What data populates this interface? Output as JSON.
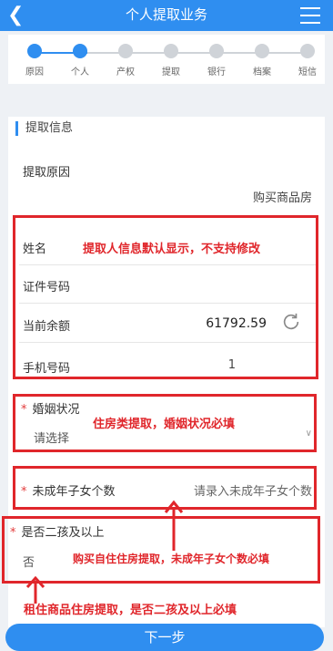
{
  "header": {
    "title": "个人提取业务"
  },
  "steps": [
    {
      "label": "原因",
      "done": true
    },
    {
      "label": "个人",
      "done": true
    },
    {
      "label": "产权",
      "done": false
    },
    {
      "label": "提取",
      "done": false
    },
    {
      "label": "银行",
      "done": false
    },
    {
      "label": "档案",
      "done": false
    },
    {
      "label": "短信",
      "done": false
    }
  ],
  "info": {
    "section_title": "提取信息",
    "reason_label": "提取原因",
    "reason_value": "购买商品房",
    "name_label": "姓名",
    "id_label": "证件号码",
    "balance_label": "当前余额",
    "balance_value": "61792.59",
    "phone_label": "手机号码",
    "phone_value": "1",
    "marriage_label": "婚姻状况",
    "marriage_value": "请选择",
    "children_label": "未成年子女个数",
    "children_placeholder": "请录入未成年子女个数",
    "second_child_label": "是否二孩及以上",
    "second_child_value": "否"
  },
  "annotations": {
    "personal_info": "提取人信息默认显示，不支持修改",
    "marriage": "住房类提取，婚姻状况必填",
    "children": "购买自住住房提取，未成年子女个数必填",
    "second_child": "租住商品住房提取，是否二孩及以上必填"
  },
  "footer": {
    "next_label": "下一步"
  },
  "colors": {
    "primary": "#2f8ef0",
    "annotation": "#e0262b"
  }
}
